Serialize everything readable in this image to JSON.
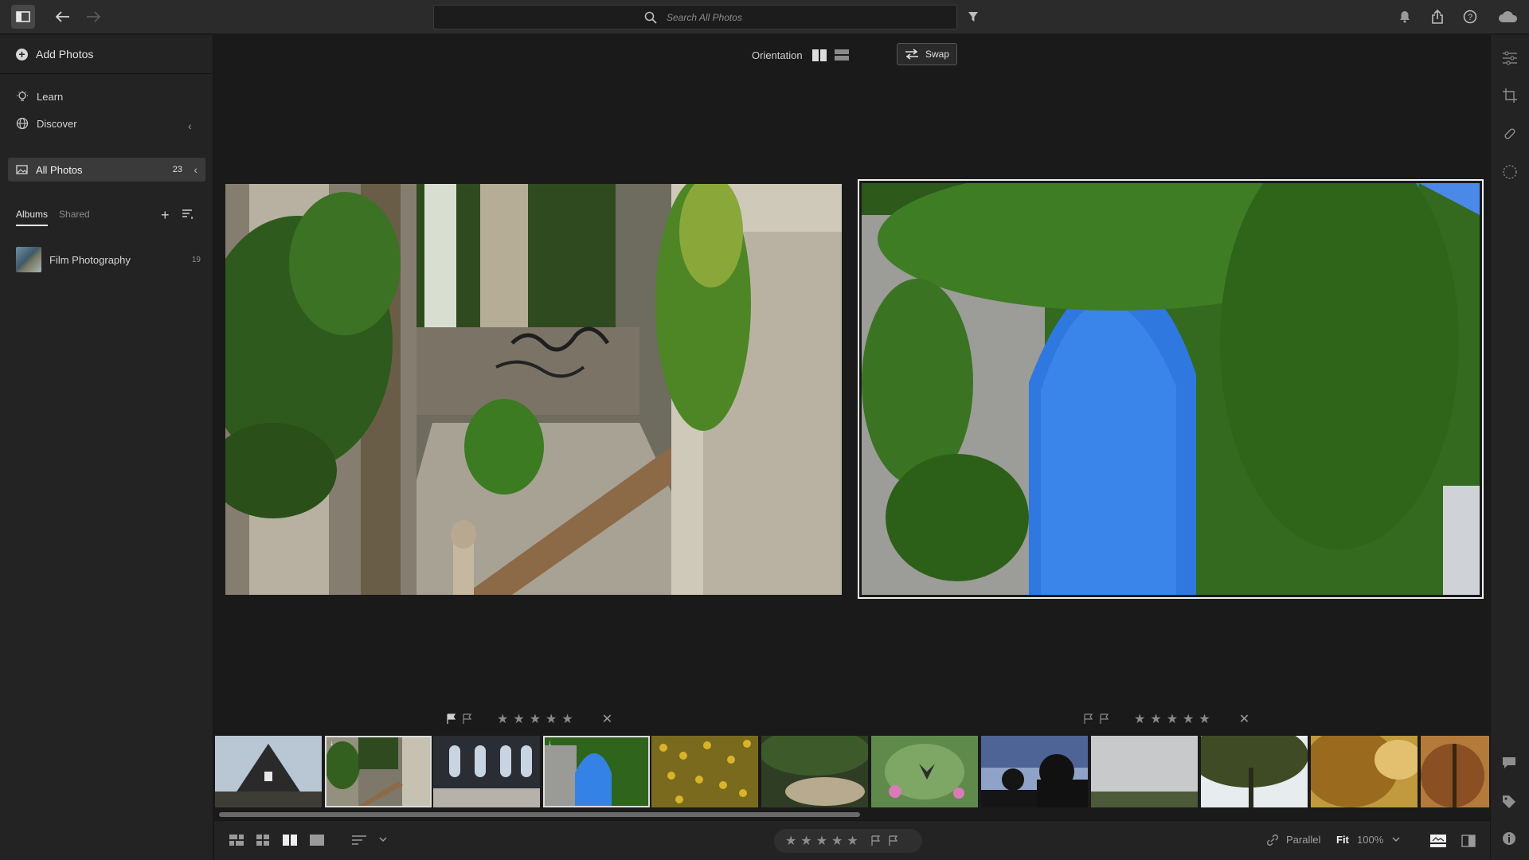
{
  "search": {
    "placeholder": "Search All Photos"
  },
  "sidebar": {
    "add_photos_label": "Add Photos",
    "learn_label": "Learn",
    "discover_label": "Discover",
    "all_photos_label": "All Photos",
    "all_photos_count": "23",
    "tabs": {
      "albums": "Albums",
      "shared": "Shared"
    },
    "albums": [
      {
        "label": "Film Photography",
        "count": "19"
      }
    ]
  },
  "compare": {
    "orientation_label": "Orientation",
    "swap_label": "Swap"
  },
  "bottom": {
    "parallel_label": "Parallel",
    "fit_label": "Fit",
    "zoom_label": "100%"
  },
  "rating": {
    "stars": "★★★★★",
    "reject": "✕"
  },
  "colors": {
    "accent_border": "#f2f2f2",
    "panel": "#232323",
    "background": "#1a1a1a"
  }
}
